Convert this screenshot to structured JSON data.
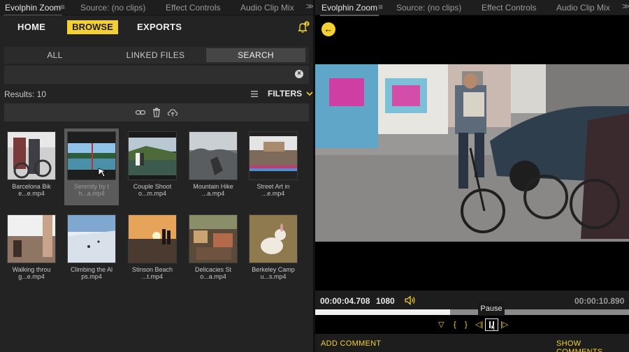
{
  "left_tabs": {
    "active": "Evolphin Zoom",
    "items": [
      "Source: (no clips)",
      "Effect Controls",
      "Audio Clip Mix"
    ]
  },
  "right_tabs": {
    "active": "Evolphin Zoom",
    "items": [
      "Source: (no clips)",
      "Effect Controls",
      "Audio Clip Mix"
    ]
  },
  "overflow_icon": ">>",
  "menu_icon": "≡",
  "nav": {
    "home": "HOME",
    "browse": "BROWSE",
    "exports": "EXPORTS",
    "bell_badge": "2"
  },
  "segments": {
    "all": "ALL",
    "linked": "LINKED FILES",
    "search": "SEARCH"
  },
  "search": {
    "clear_icon": "×"
  },
  "results_label": "Results: 10",
  "filters_label": "FILTERS",
  "assets": [
    {
      "line1": "Barcelona Bik",
      "line2": "e...e.mp4"
    },
    {
      "line1": "Serenity by t",
      "line2": "h...a.mp4"
    },
    {
      "line1": "Couple Shoot",
      "line2": "o...m.mp4"
    },
    {
      "line1": "Mountain Hike",
      "line2": "...a.mp4"
    },
    {
      "line1": "Street Art in",
      "line2": "...e.mp4"
    },
    {
      "line1": "Walking throu",
      "line2": "g...e.mp4"
    },
    {
      "line1": "Climbing the Al",
      "line2": "ps.mp4"
    },
    {
      "line1": "Stinson Beach",
      "line2": "...t.mp4"
    },
    {
      "line1": "Delicacies St",
      "line2": "o...a.mp4"
    },
    {
      "line1": "Berkeley Camp",
      "line2": "u...s.mp4"
    }
  ],
  "player": {
    "back_icon": "←",
    "current_time": "00:00:04.708",
    "resolution": "1080",
    "duration": "00:00:10.890",
    "progress_fraction": 0.43,
    "tooltip": "Pause",
    "icons": {
      "mark": "▽",
      "in": "{",
      "out": "}",
      "prev": "◁|",
      "next": "|▷"
    }
  },
  "footer": {
    "add_comment": "ADD COMMENT",
    "show_comments": "SHOW COMMENTS"
  },
  "colors": {
    "accent": "#f5d033",
    "panel": "#232323"
  }
}
